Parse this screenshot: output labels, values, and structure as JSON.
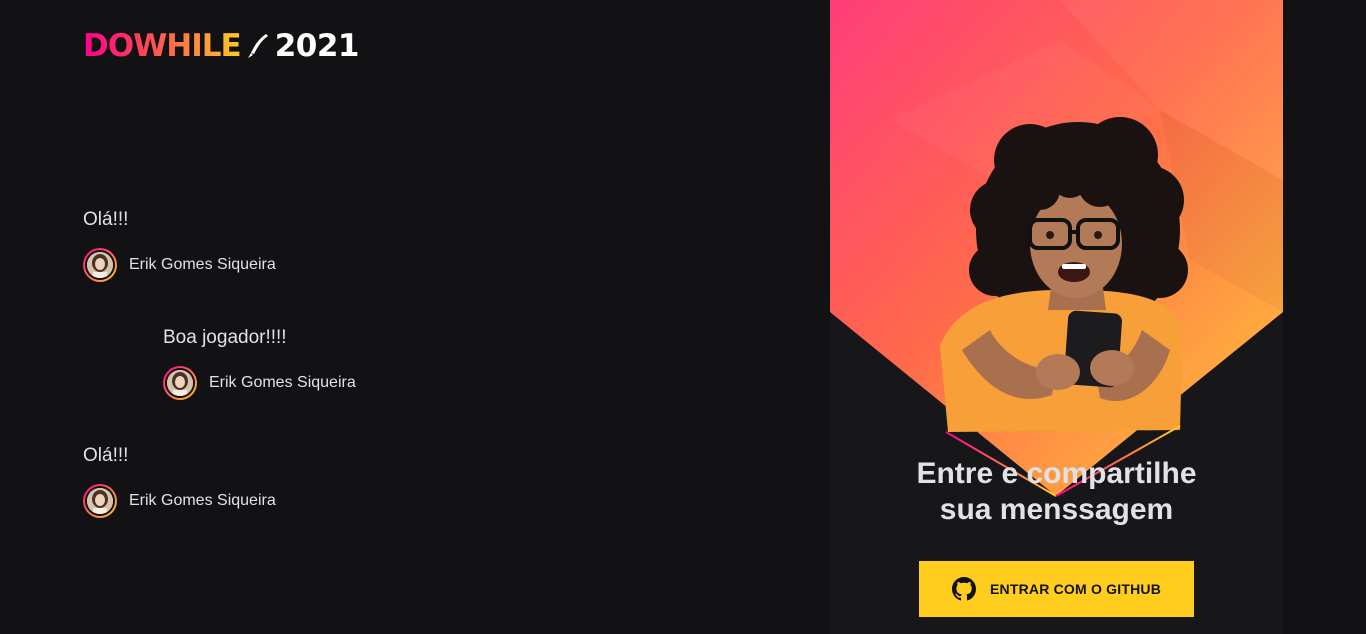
{
  "logo": {
    "word": "DOWHILE",
    "year": "2021"
  },
  "messages": [
    {
      "content": "Olá!!!",
      "user": "Erik Gomes Siqueira"
    },
    {
      "content": "Boa jogador!!!!",
      "user": "Erik Gomes Siqueira"
    },
    {
      "content": "Olá!!!",
      "user": "Erik Gomes Siqueira"
    }
  ],
  "login": {
    "title_line1": "Entre e compartilhe",
    "title_line2": "sua menssagem",
    "button_label": "ENTRAR COM O GITHUB",
    "button_icon": "github-icon"
  },
  "colors": {
    "background": "#121214",
    "panel": "#17171a",
    "accent_pink": "#ff008e",
    "accent_yellow": "#ffcd1e",
    "text": "#e1e1e6"
  }
}
